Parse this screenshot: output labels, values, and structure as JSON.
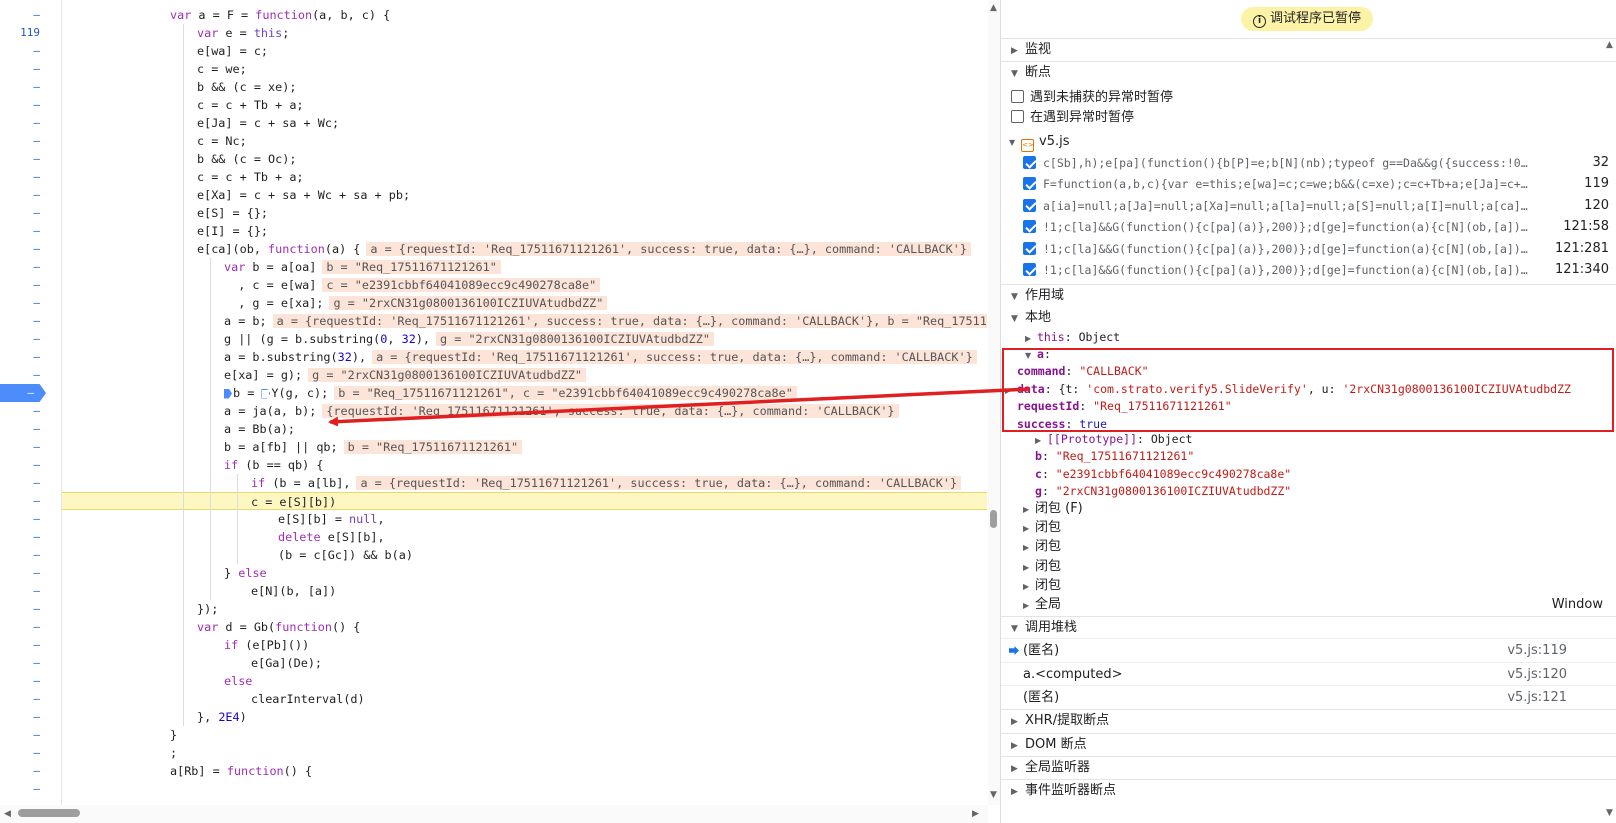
{
  "editor": {
    "gutter": [
      "–",
      "119",
      "–",
      "–",
      "–",
      "–",
      "–",
      "–",
      "–",
      "–",
      "–",
      "–",
      "–",
      "–",
      "–",
      "–",
      "–",
      "–",
      "–",
      "–",
      "–",
      "–",
      "–",
      "–",
      "–",
      "–",
      "–",
      "–",
      "–",
      "–",
      "–",
      "–",
      "–",
      "–",
      "–",
      "–",
      "–",
      "–",
      "–",
      "–",
      "–",
      "–",
      "–",
      "–"
    ],
    "breakpoint_line_index": 21,
    "paused_line_index": 27,
    "lines": [
      {
        "indent": 4,
        "t": "var a = F = function(a, b, c) {"
      },
      {
        "indent": 5,
        "t": "var e = this;"
      },
      {
        "indent": 5,
        "t": "e[wa] = c;"
      },
      {
        "indent": 5,
        "t": "c = we;"
      },
      {
        "indent": 5,
        "t": "b && (c = xe);"
      },
      {
        "indent": 5,
        "t": "c = c + Tb + a;"
      },
      {
        "indent": 5,
        "t": "e[Ja] = c + sa + Wc;"
      },
      {
        "indent": 5,
        "t": "c = Nc;"
      },
      {
        "indent": 5,
        "t": "b && (c = Oc);"
      },
      {
        "indent": 5,
        "t": "c = c + Tb + a;"
      },
      {
        "indent": 5,
        "t": "e[Xa] = c + sa + Wc + sa + pb;"
      },
      {
        "indent": 5,
        "t": "e[S] = {};"
      },
      {
        "indent": 5,
        "t": "e[I] = {};"
      },
      {
        "indent": 5,
        "t": "e[ca](ob, function(a) {",
        "inl": "a = {requestId: 'Req_17511671121261', success: true, data: {…}, command: 'CALLBACK'}"
      },
      {
        "indent": 6,
        "t": "var b = a[oa]",
        "inl": "b = \"Req_17511671121261\""
      },
      {
        "indent": 6,
        "t": "  , c = e[wa]",
        "inl": "c = \"e2391cbbf64041089ecc9c490278ca8e\""
      },
      {
        "indent": 6,
        "t": "  , g = e[xa];",
        "inl": "g = \"2rxCN31g0800136100ICZIUVAtudbdZZ\""
      },
      {
        "indent": 6,
        "t": "a = b;",
        "inl": "a = {requestId: 'Req_17511671121261', success: true, data: {…}, command: 'CALLBACK'}, b = \"Req_17511671121261\""
      },
      {
        "indent": 6,
        "t": "g || (g = b.substring(0, 32),",
        "inl": "g = \"2rxCN31g0800136100ICZIUVAtudbdZZ\""
      },
      {
        "indent": 6,
        "t": "a = b.substring(32),",
        "inl": "a = {requestId: 'Req_17511671121261', success: true, data: {…}, command: 'CALLBACK'}"
      },
      {
        "indent": 6,
        "t": "e[xa] = g);",
        "inl": "g = \"2rxCN31g0800136100ICZIUVAtudbdZZ\""
      },
      {
        "indent": 6,
        "t": "b = Y(g, c);",
        "inl": "b = \"Req_17511671121261\", c = \"e2391cbbf64041089ecc9c490278ca8e\"",
        "marks": true
      },
      {
        "indent": 6,
        "t": "a = ja(a, b);",
        "inl": "{requestId: 'Req_17511671121261', success: true, data: {…}, command: 'CALLBACK'}"
      },
      {
        "indent": 6,
        "t": "a = Bb(a);"
      },
      {
        "indent": 6,
        "t": "b = a[fb] || qb;",
        "inl": "b = \"Req_17511671121261\""
      },
      {
        "indent": 6,
        "t": "if (b == qb) {"
      },
      {
        "indent": 7,
        "t": "if (b = a[lb],",
        "inl": "a = {requestId: 'Req_17511671121261', success: true, data: {…}, command: 'CALLBACK'}"
      },
      {
        "indent": 7,
        "t": "c = e[S][b])"
      },
      {
        "indent": 8,
        "t": "e[S][b] = null,"
      },
      {
        "indent": 8,
        "t": "delete e[S][b],"
      },
      {
        "indent": 8,
        "t": "(b = c[Gc]) && b(a)"
      },
      {
        "indent": 6,
        "t": "} else"
      },
      {
        "indent": 7,
        "t": "e[N](b, [a])"
      },
      {
        "indent": 5,
        "t": "});"
      },
      {
        "indent": 5,
        "t": "var d = Gb(function() {"
      },
      {
        "indent": 6,
        "t": "if (e[Pb]())"
      },
      {
        "indent": 7,
        "t": "e[Ga](De);"
      },
      {
        "indent": 6,
        "t": "else"
      },
      {
        "indent": 7,
        "t": "clearInterval(d)"
      },
      {
        "indent": 5,
        "t": "}, 2E4)"
      },
      {
        "indent": 4,
        "t": "}"
      },
      {
        "indent": 4,
        "t": ";"
      },
      {
        "indent": 4,
        "t": "a[Rb] = function() {"
      },
      {
        "indent": 5,
        "t": "  "
      }
    ]
  },
  "debugger": {
    "paused_banner": "调试程序已暂停",
    "sections": {
      "watch": "监视",
      "breakpoints": "断点",
      "scope": "作用域",
      "local": "本地",
      "call_stack": "调用堆栈",
      "xhr": "XHR/提取断点",
      "dom": "DOM 断点",
      "global_listeners": "全局监听器",
      "event_listeners": "事件监听器断点"
    },
    "pause_options": [
      {
        "label": "遇到未捕获的异常时暂停",
        "checked": false
      },
      {
        "label": "在遇到异常时暂停",
        "checked": false
      }
    ],
    "bp_file": "v5.js",
    "breakpoints": [
      {
        "code": "c[Sb],h);e[pa](function(){b[P]=e;b[N](nb);typeof g==Da&&g({success:!0})})}…",
        "line": "32"
      },
      {
        "code": "F=function(a,b,c){var e=this;e[wa]=c;c=we;b&&(c=xe);c=c+Tb+a;e[Ja]=c+sa+W…",
        "line": "119"
      },
      {
        "code": "a[ia]=null;a[Ja]=null;a[Xa]=null;a[la]=null;a[S]=null;a[I]=null;a[ca]=fun…",
        "line": "120"
      },
      {
        "code": "!1;c[la]&&G(function(){c[pa](a)},200)};d[ge]=function(a){c[N](ob,[a])}…",
        "line": "121:58"
      },
      {
        "code": "!1;c[la]&&G(function(){c[pa](a)},200)};d[ge]=function(a){c[N](ob,[a])}…",
        "line": "121:281"
      },
      {
        "code": "!1;c[la]&&G(function(){c[pa](a)},200)};d[ge]=function(a){c[N](ob,[a])}…",
        "line": "121:340"
      }
    ],
    "scope": {
      "this_name": "this",
      "this_value": "Object",
      "a_name": "a",
      "a_props": [
        {
          "k": "command",
          "v": "\"CALLBACK\"",
          "type": "str"
        },
        {
          "k": "data",
          "v": "{t: 'com.strato.verify5.SlideVerify', u: '2rxCN31g0800136100ICZIUVAtudbdZZ",
          "type": "obj"
        },
        {
          "k": "requestId",
          "v": "\"Req_17511671121261\"",
          "type": "str"
        },
        {
          "k": "success",
          "v": "true",
          "type": "kw"
        }
      ],
      "prototype_name": "[[Prototype]]",
      "prototype_value": "Object",
      "vars": [
        {
          "k": "b",
          "v": "\"Req_17511671121261\""
        },
        {
          "k": "c",
          "v": "\"e2391cbbf64041089ecc9c490278ca8e\""
        },
        {
          "k": "g",
          "v": "\"2rxCN31g0800136100ICZIUVAtudbdZZ\""
        }
      ],
      "closures": [
        "闭包 (F)",
        "闭包",
        "闭包",
        "闭包",
        "闭包"
      ],
      "global_label": "全局",
      "global_value": "Window"
    },
    "call_stack": [
      {
        "fn": "(匿名)",
        "loc": "v5.js:119",
        "current": true
      },
      {
        "fn": "a.<computed>",
        "loc": "v5.js:120",
        "current": false
      },
      {
        "fn": "(匿名)",
        "loc": "v5.js:121",
        "current": false
      }
    ]
  },
  "colors": {
    "accent": "#1a73e8",
    "paused_line": "#fff7c2",
    "inline_value_bg": "#fde4d9",
    "annotation_red": "#e02020"
  }
}
